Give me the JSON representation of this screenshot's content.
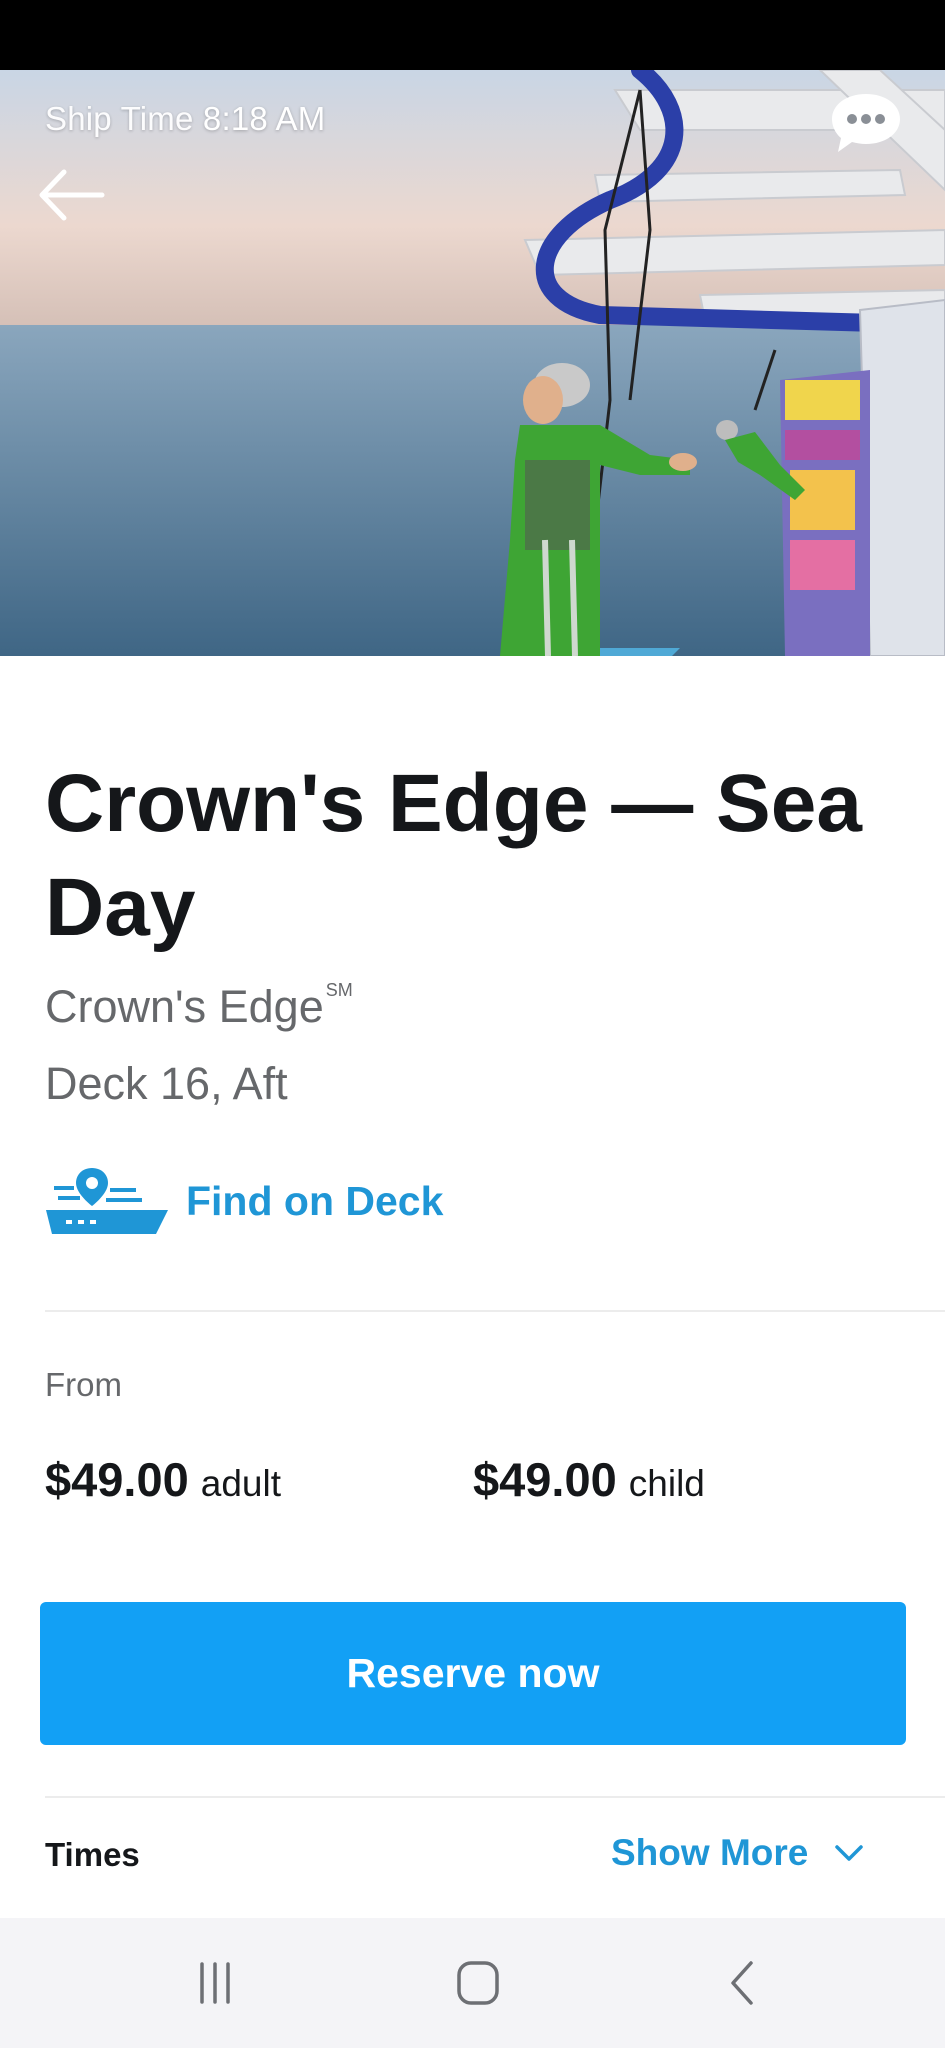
{
  "header": {
    "ship_time_label": "Ship Time",
    "ship_time_value": "8:18 AM"
  },
  "activity": {
    "title": "Crown's Edge — Sea Day",
    "venue": "Crown's Edge",
    "venue_mark": "SM",
    "location": "Deck 16, Aft",
    "find_on_deck_label": "Find on Deck"
  },
  "pricing": {
    "from_label": "From",
    "adult": {
      "amount": "$49.00",
      "unit": "adult"
    },
    "child": {
      "amount": "$49.00",
      "unit": "child"
    }
  },
  "actions": {
    "reserve_label": "Reserve now"
  },
  "times": {
    "label": "Times",
    "show_more_label": "Show More"
  },
  "icons": {
    "back": "back-arrow-icon",
    "chat": "chat-bubble-icon",
    "ship_pin": "ship-location-icon",
    "chevron": "chevron-down-icon",
    "nav_recents": "recents-icon",
    "nav_home": "home-icon",
    "nav_back": "nav-back-icon"
  },
  "colors": {
    "accent_blue": "#1f96d6",
    "button_blue": "#12a0f5",
    "text_dark": "#15171a",
    "text_gray": "#66686b"
  }
}
